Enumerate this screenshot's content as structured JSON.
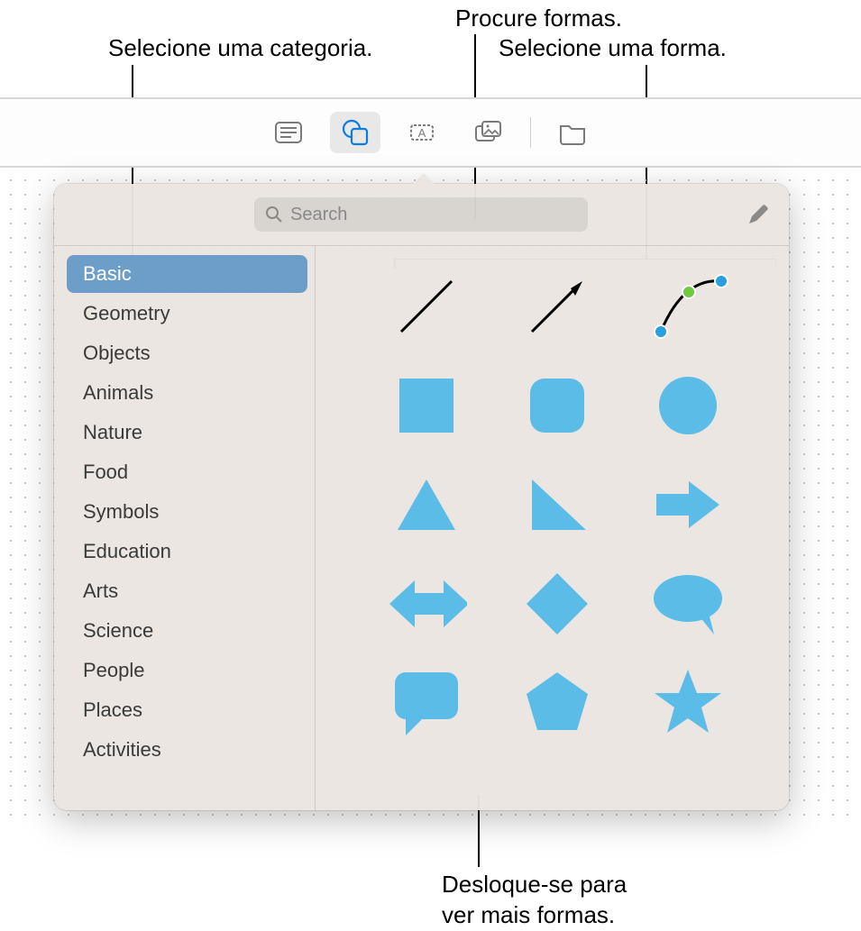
{
  "callouts": {
    "category": "Selecione uma categoria.",
    "search": "Procure formas.",
    "select_shape": "Selecione uma forma.",
    "scroll": "Desloque-se para\nver mais formas."
  },
  "toolbar": {
    "buttons": [
      {
        "name": "text-icon",
        "active": false
      },
      {
        "name": "shapes-icon",
        "active": true
      },
      {
        "name": "textbox-icon",
        "active": false
      },
      {
        "name": "media-icon",
        "active": false
      },
      {
        "name": "folder-icon",
        "active": false
      }
    ]
  },
  "popover": {
    "search": {
      "placeholder": "Search"
    },
    "pen_tool": "edit-pen-icon",
    "categories": [
      "Basic",
      "Geometry",
      "Objects",
      "Animals",
      "Nature",
      "Food",
      "Symbols",
      "Education",
      "Arts",
      "Science",
      "People",
      "Places",
      "Activities"
    ],
    "selected_category_index": 0,
    "shapes": [
      "line",
      "arrow-line",
      "curve",
      "square",
      "rounded-square",
      "circle",
      "triangle",
      "right-triangle",
      "arrow-right",
      "double-arrow",
      "diamond",
      "speech-oval",
      "speech-square",
      "pentagon",
      "star"
    ],
    "shape_color": "#5bbce8"
  }
}
